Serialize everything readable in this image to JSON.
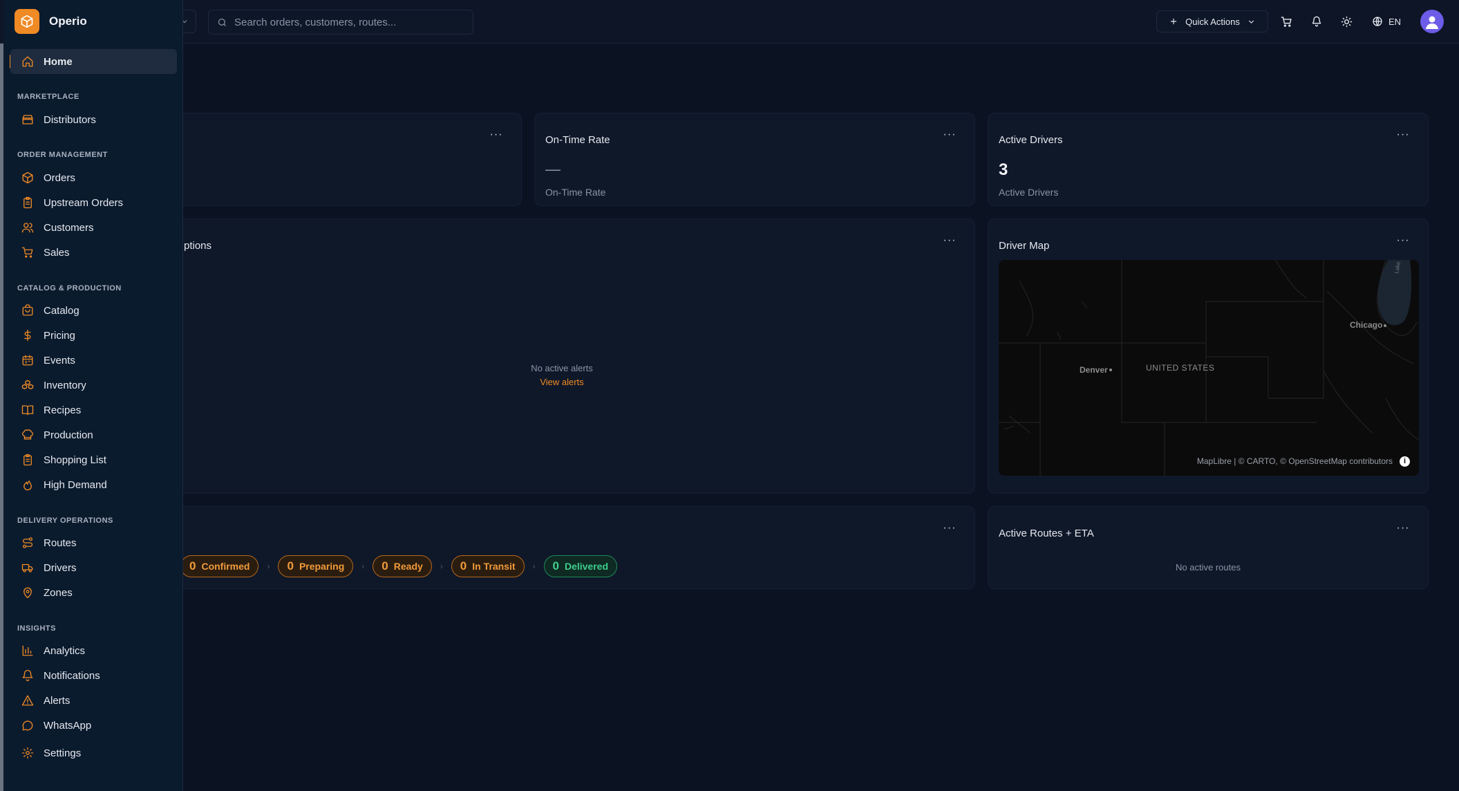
{
  "brand": {
    "name": "Operio",
    "accent": "#f08a24"
  },
  "topbar": {
    "search_placeholder": "Search orders, customers, routes...",
    "quick_actions_label": "Quick Actions",
    "language": "EN"
  },
  "sidebar": {
    "home": {
      "label": "Home",
      "icon": "home-icon"
    },
    "sections": [
      {
        "title": "MARKETPLACE",
        "items": [
          {
            "label": "Distributors",
            "icon": "store-icon"
          }
        ]
      },
      {
        "title": "ORDER MANAGEMENT",
        "items": [
          {
            "label": "Orders",
            "icon": "package-icon"
          },
          {
            "label": "Upstream Orders",
            "icon": "clipboard-icon"
          },
          {
            "label": "Customers",
            "icon": "users-icon"
          },
          {
            "label": "Sales",
            "icon": "cart-icon"
          }
        ]
      },
      {
        "title": "CATALOG & PRODUCTION",
        "items": [
          {
            "label": "Catalog",
            "icon": "bag-icon"
          },
          {
            "label": "Pricing",
            "icon": "dollar-icon"
          },
          {
            "label": "Events",
            "icon": "calendar-icon"
          },
          {
            "label": "Inventory",
            "icon": "boxes-icon"
          },
          {
            "label": "Recipes",
            "icon": "book-icon"
          },
          {
            "label": "Production",
            "icon": "chef-hat-icon"
          },
          {
            "label": "Shopping List",
            "icon": "list-icon"
          },
          {
            "label": "High Demand",
            "icon": "flame-icon"
          }
        ]
      },
      {
        "title": "DELIVERY OPERATIONS",
        "items": [
          {
            "label": "Routes",
            "icon": "route-icon"
          },
          {
            "label": "Drivers",
            "icon": "truck-icon"
          },
          {
            "label": "Zones",
            "icon": "map-pin-icon"
          }
        ]
      },
      {
        "title": "INSIGHTS",
        "items": [
          {
            "label": "Analytics",
            "icon": "bar-chart-icon"
          },
          {
            "label": "Notifications",
            "icon": "bell-icon"
          },
          {
            "label": "Alerts",
            "icon": "alert-triangle-icon"
          },
          {
            "label": "WhatsApp",
            "icon": "message-icon"
          }
        ]
      }
    ],
    "settings": {
      "label": "Settings",
      "icon": "gear-icon"
    }
  },
  "kpis": {
    "on_time": {
      "title": "On-Time Rate",
      "value": "—",
      "subtitle": "On-Time Rate"
    },
    "active_drivers": {
      "title": "Active Drivers",
      "value": "3",
      "subtitle": "Active Drivers"
    }
  },
  "exceptions": {
    "title_fragment": "ptions",
    "empty": "No active alerts",
    "link": "View alerts"
  },
  "driver_map": {
    "title": "Driver Map",
    "labels": {
      "denver": "Denver",
      "chicago": "Chicago",
      "country": "UNITED STATES",
      "lake": "Lake Mi"
    },
    "attribution": "MapLibre | © CARTO, © OpenStreetMap contributors"
  },
  "pipeline": {
    "stages": [
      {
        "count": "0",
        "label": "Confirmed",
        "color": "orange"
      },
      {
        "count": "0",
        "label": "Preparing",
        "color": "orange"
      },
      {
        "count": "0",
        "label": "Ready",
        "color": "orange"
      },
      {
        "count": "0",
        "label": "In Transit",
        "color": "orange"
      },
      {
        "count": "0",
        "label": "Delivered",
        "color": "green"
      }
    ]
  },
  "routes": {
    "title": "Active Routes + ETA",
    "empty": "No active routes"
  },
  "colors": {
    "background": "#0b1221",
    "card": "#0f1829",
    "sidebar": "#0b1b2e",
    "success": "#3fcf8e"
  }
}
